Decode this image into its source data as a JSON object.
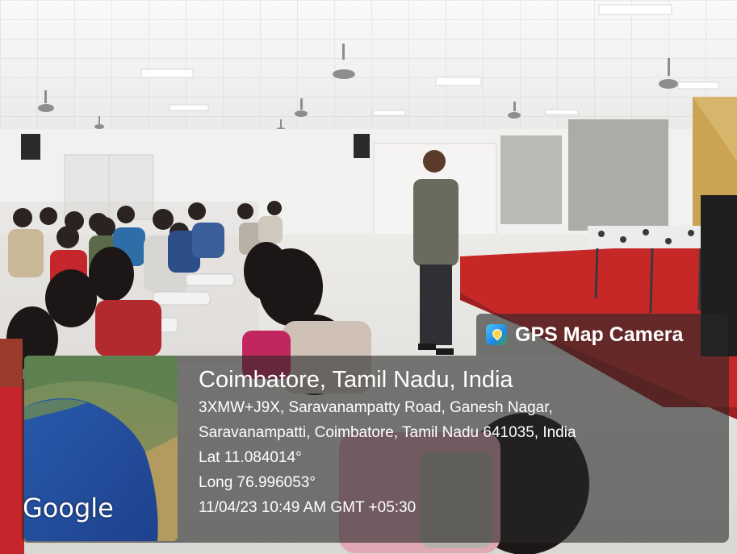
{
  "overlay": {
    "app_name": "GPS Map Camera",
    "location_title": "Coimbatore, Tamil Nadu, India",
    "address_line_1": "3XMW+J9X, Saravanampatty Road, Ganesh Nagar,",
    "address_line_2": "Saravanampatti, Coimbatore, Tamil Nadu 641035, India",
    "latitude": "Lat 11.084014°",
    "longitude": "Long 76.996053°",
    "timestamp": "11/04/23 10:49 AM GMT +05:30",
    "map_brand": "Google",
    "icon": "gps-map-camera-app-icon"
  },
  "colors": {
    "overlay_bg": "#282828",
    "stage_red": "#c62828",
    "floor": "#e7e7e5",
    "ceiling": "#f3f3f3"
  }
}
